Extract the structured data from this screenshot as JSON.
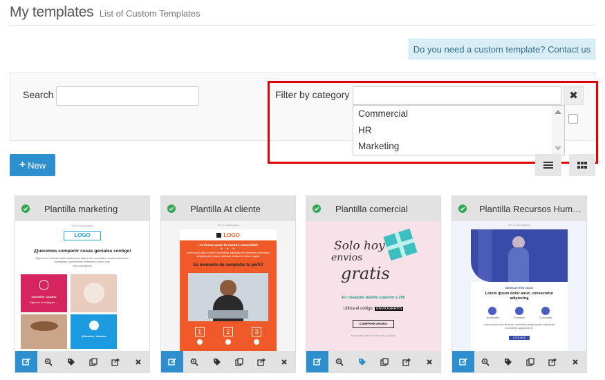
{
  "header": {
    "title": "My templates",
    "subtitle": "List of Custom Templates"
  },
  "contact": {
    "text": "Do you need a custom template? Contact us"
  },
  "filters": {
    "search_label": "Search",
    "search_value": "",
    "category_label": "Filter by category",
    "category_value": "",
    "clear_symbol": "✖",
    "categories": [
      "Commercial",
      "HR",
      "Marketing"
    ]
  },
  "toolbar": {
    "new_label": "New",
    "new_icon": "plus-icon"
  },
  "colors": {
    "accent": "#2e8fce",
    "check": "#2fa84f",
    "highlight": "#e00000"
  },
  "templates": [
    {
      "name": "Plantilla marketing",
      "preview": {
        "top": "Ver en navegador",
        "logo": "LOGO",
        "headline": "¡Queremos compartir cosas geniales contigo!",
        "body": "Sigueme en nuestras redes sociales para estar al día: novedades, nuevas colecciones, curiosidades, promociones exclusivas y mucho más.",
        "follow": "¡Nos conectamos!",
        "handle1": "@Nombre_Usuario",
        "handle1_sub": "Síguenos en Instagram →",
        "handle2": "@Nombre_Usuario"
      }
    },
    {
      "name": "Plantilla At cliente",
      "preview": {
        "top": "Ver en navegador",
        "logo": "LOGO",
        "headline": "¡Ya formas parte de nuestra comunidad!",
        "body": "Lorem ipsum dolor sit amet, consectetur adipiscing elit. Maecenas consectetur adipiscing elit, tempor incididunt ut labore et dolore magna.",
        "cta": "Es momento de completar tu perfil!",
        "steps": [
          "1",
          "2",
          "3"
        ]
      }
    },
    {
      "name": "Plantilla comercial",
      "preview": {
        "line1": "Solo hoy",
        "line2": "envios",
        "line3": "gratis",
        "offer": "En cualquier pedido superior a 25€",
        "code_label": "Utiliza el código:",
        "code": "ENVIOGRATIS",
        "button": "COMPRAR AHORA",
        "fine": "Envío gratis válido en todos los productos"
      }
    },
    {
      "name": "Plantilla Recursos Hum…",
      "preview": {
        "top": "Ver en navegador",
        "tag": "NEWSLETTER JULIO",
        "headline": "Lorem ipsum dolor amet, consectetur adipiscing",
        "body": "Lorem ipsum dolor sit amet, consectetur adipiscing elit. Maecenas consectetur adipiscing elit.",
        "button": "LEER MÁS",
        "icons": [
          "Novedades",
          "Formación",
          "Comunidad"
        ]
      }
    }
  ],
  "card_actions": [
    "edit-icon",
    "zoom-icon",
    "tag-icon",
    "duplicate-icon",
    "share-icon",
    "delete-icon"
  ]
}
